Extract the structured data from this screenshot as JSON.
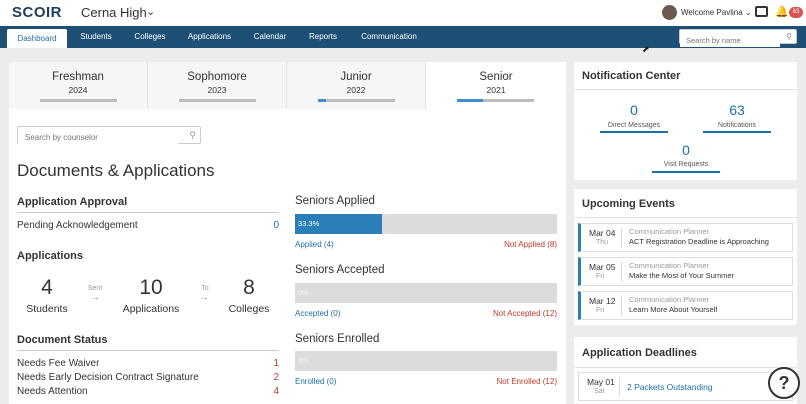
{
  "header": {
    "logo": "SCOIR",
    "school_name": "Cerna High",
    "welcome": "Welcome Pavlina",
    "notification_badge": "63"
  },
  "nav": {
    "tabs": [
      "Dashboard",
      "Students",
      "Colleges",
      "Applications",
      "Calendar",
      "Reports",
      "Communication"
    ],
    "active_tab": "Dashboard",
    "search_placeholder": "Search by name"
  },
  "class_tabs": [
    {
      "name": "Freshman",
      "year": "2024",
      "progress": 0
    },
    {
      "name": "Sophomore",
      "year": "2023",
      "progress": 0
    },
    {
      "name": "Junior",
      "year": "2022",
      "progress": 0.1
    },
    {
      "name": "Senior",
      "year": "2021",
      "progress": 0.333
    }
  ],
  "selected_class": "Senior",
  "counselor_search_placeholder": "Search by counselor",
  "documents": {
    "title": "Documents & Applications",
    "approval": {
      "title": "Application Approval",
      "label": "Pending Acknowledgement",
      "value": "0"
    },
    "applications": {
      "title": "Applications",
      "students_count": "4",
      "students_label": "Students",
      "sent_label": "Sent",
      "apps_count": "10",
      "apps_label": "Applications",
      "to_label": "To",
      "colleges_count": "8",
      "colleges_label": "Colleges"
    },
    "status": {
      "title": "Document Status",
      "items": [
        {
          "label": "Needs Fee Waiver",
          "value": "1"
        },
        {
          "label": "Needs Early Decision Contract Signature",
          "value": "2"
        },
        {
          "label": "Needs Attention",
          "value": "4"
        }
      ]
    }
  },
  "metrics": [
    {
      "title": "Seniors Applied",
      "percent_text": "33.3%",
      "fraction": 0.333,
      "positive_link": "Applied (4)",
      "negative_link": "Not Applied (8)"
    },
    {
      "title": "Seniors Accepted",
      "percent_text": "0%",
      "fraction": 0,
      "positive_link": "Accepted (0)",
      "negative_link": "Not Accepted (12)"
    },
    {
      "title": "Seniors Enrolled",
      "percent_text": "0%",
      "fraction": 0,
      "positive_link": "Enrolled (0)",
      "negative_link": "Not Enrolled (12)"
    }
  ],
  "notification_center": {
    "title": "Notification Center",
    "direct_messages": {
      "count": "0",
      "label": "Direct Messages"
    },
    "notifications": {
      "count": "63",
      "label": "Notifications"
    },
    "visit_requests": {
      "count": "0",
      "label": "Visit Requests"
    }
  },
  "upcoming_events": {
    "title": "Upcoming Events",
    "items": [
      {
        "date": "Mar 04",
        "day": "Thu",
        "source": "Communication Planner",
        "name": "ACT Registration Deadline is Approaching"
      },
      {
        "date": "Mar 05",
        "day": "Fri",
        "source": "Communication Planner",
        "name": "Make the Most of Your Summer"
      },
      {
        "date": "Mar 12",
        "day": "Fri",
        "source": "Communication Planner",
        "name": "Learn More About Yourself"
      }
    ]
  },
  "application_deadlines": {
    "title": "Application Deadlines",
    "items": [
      {
        "date": "May 01",
        "day": "Sat",
        "name": "2 Packets Outstanding"
      }
    ]
  },
  "colors": {
    "nav_bg": "#1e4f74",
    "accent": "#1e6fa8",
    "bar_fill": "#2a7fb8",
    "negative": "#c0392b"
  }
}
